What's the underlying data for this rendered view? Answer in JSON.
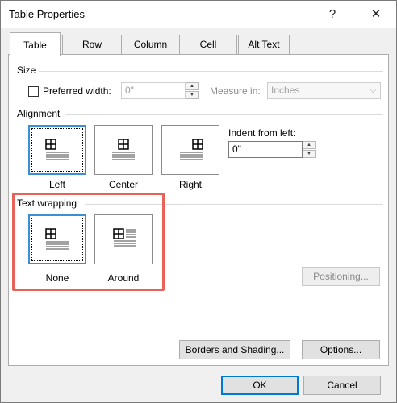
{
  "window": {
    "title": "Table Properties",
    "help_glyph": "?",
    "close_glyph": "✕"
  },
  "tabs": [
    {
      "label": "Table",
      "active": true
    },
    {
      "label": "Row",
      "active": false
    },
    {
      "label": "Column",
      "active": false
    },
    {
      "label": "Cell",
      "active": false
    },
    {
      "label": "Alt Text",
      "active": false
    }
  ],
  "size": {
    "section_label": "Size",
    "preferred_width_label": "Preferred width:",
    "preferred_width_checked": false,
    "preferred_width_value": "0\"",
    "measure_in_label": "Measure in:",
    "measure_in_value": "Inches"
  },
  "alignment": {
    "section_label": "Alignment",
    "options": [
      "Left",
      "Center",
      "Right"
    ],
    "selected": "Left",
    "indent_label": "Indent from left:",
    "indent_value": "0\""
  },
  "text_wrapping": {
    "section_label": "Text wrapping",
    "options": [
      "None",
      "Around"
    ],
    "selected": "None",
    "highlight_color": "#e8625a"
  },
  "buttons": {
    "positioning": "Positioning...",
    "borders_shading": "Borders and Shading...",
    "options": "Options...",
    "ok": "OK",
    "cancel": "Cancel"
  },
  "colors": {
    "selection_border": "#3a8fd6",
    "default_button": "#0078d7"
  }
}
